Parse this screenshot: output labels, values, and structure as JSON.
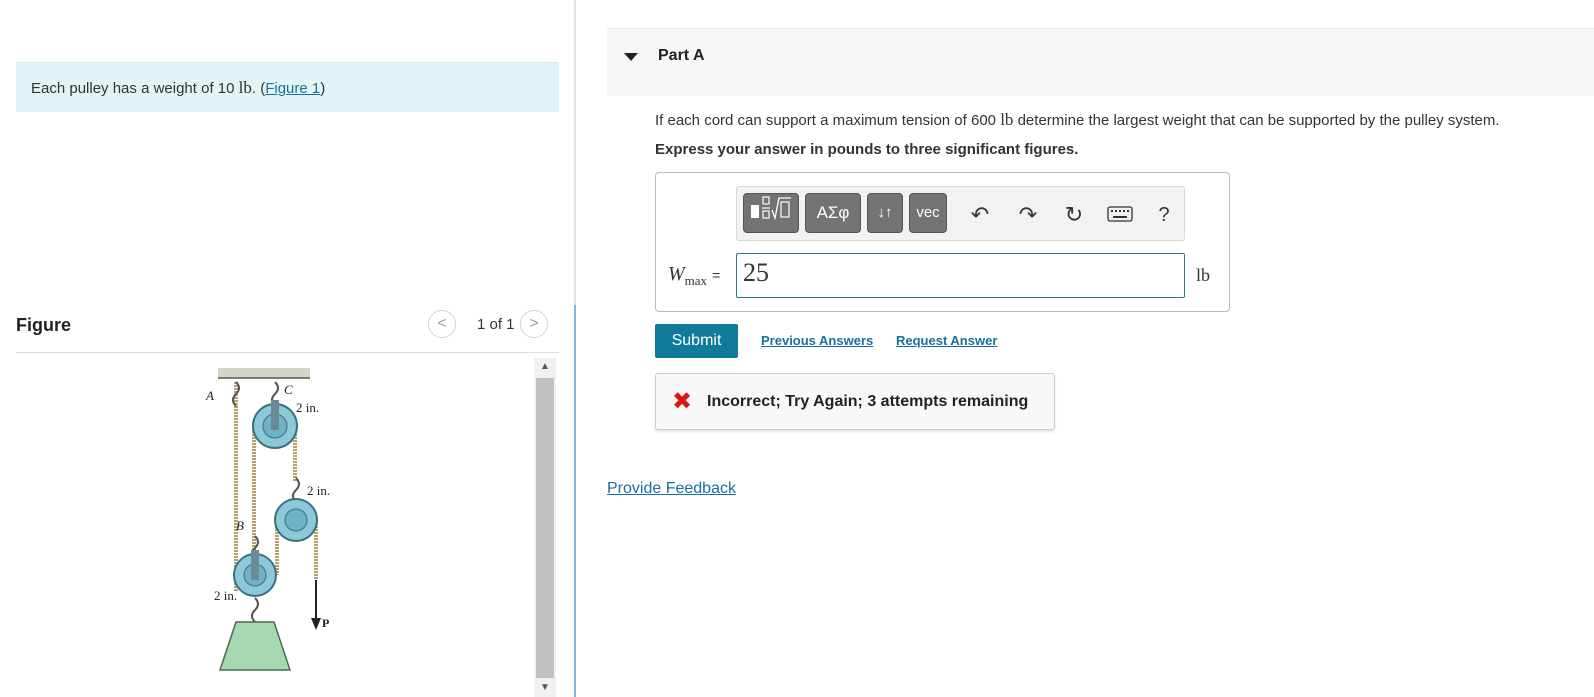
{
  "intro": {
    "text_before": "Each pulley has a weight of 10 ",
    "unit": "lb",
    "text_mid": ". (",
    "figure_link": "Figure 1",
    "text_after": ")"
  },
  "figure_panel": {
    "title": "Figure",
    "prev_icon": "chevron-left-icon",
    "next_icon": "chevron-right-icon",
    "count": "1 of 1",
    "labels": {
      "a": "A",
      "b": "B",
      "c": "C",
      "dim_top": "2 in.",
      "dim_mid": "2 in.",
      "dim_bottom": "2 in.",
      "p": "P"
    }
  },
  "part": {
    "title": "Part A",
    "question_before": "If each cord can support a maximum tension of 600 ",
    "question_unit": "lb",
    "question_after": " determine the largest weight that can be supported by the pulley system.",
    "instruction": "Express your answer in pounds to three significant figures."
  },
  "toolbar": {
    "template_icon": "fraction-radical-template-icon",
    "greek": "ΑΣφ",
    "arrows": "↓↑",
    "vec": "vec",
    "undo_icon": "undo-icon",
    "redo_icon": "redo-icon",
    "reset_icon": "reset-icon",
    "keyboard_icon": "keyboard-icon",
    "help": "?"
  },
  "answer": {
    "var_main": "W",
    "var_sub": "max",
    "equals": "=",
    "value": "25",
    "unit": "lb"
  },
  "actions": {
    "submit": "Submit",
    "previous_answers": "Previous Answers",
    "request_answer": "Request Answer"
  },
  "feedback": {
    "icon": "x-mark-icon",
    "text": "Incorrect; Try Again; 3 attempts remaining"
  },
  "provide_feedback": "Provide Feedback",
  "colors": {
    "accent": "#0f7a9a",
    "link": "#1a6f9f",
    "error": "#d21a1a",
    "intro_bg": "#e3f4f6",
    "pulley": "#8cc8d8",
    "weight": "#a8d8b0"
  }
}
